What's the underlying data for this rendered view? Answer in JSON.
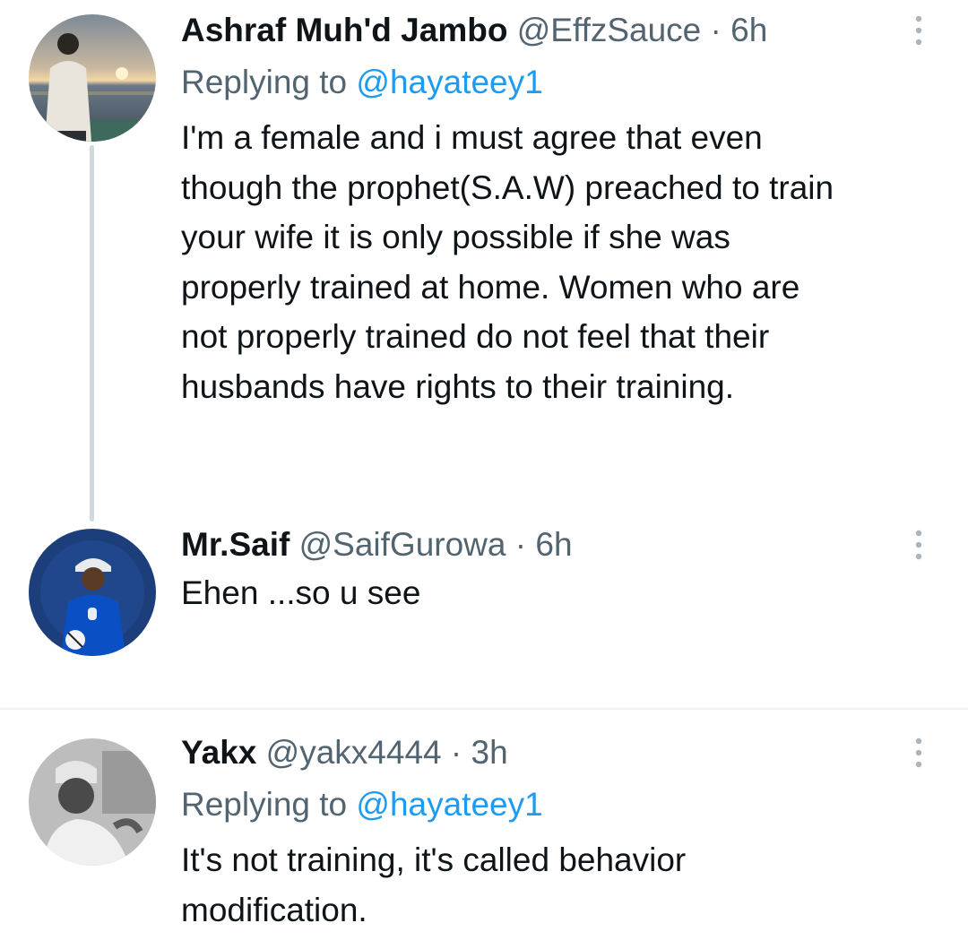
{
  "tweets": [
    {
      "name": "Ashraf Muh'd Jambo",
      "handle": "@EffzSauce",
      "separator": "·",
      "time": "6h",
      "replying_prefix": "Replying to",
      "replying_to": "@hayateey1",
      "text_lines": [
        "I'm a female and i must agree that even",
        "though the prophet(S.A.W) preached to train",
        "your wife it is only possible if she was",
        "properly trained at home. Women who are",
        "not properly trained do not feel that their",
        "husbands have rights to their training."
      ],
      "avatar_icon": "avatar-sunset-photo-icon",
      "more_icon": "more-options-icon"
    },
    {
      "name": "Mr.Saif",
      "handle": "@SaifGurowa",
      "separator": "·",
      "time": "6h",
      "text_lines": [
        "Ehen ...so u see"
      ],
      "avatar_icon": "avatar-football-player-icon",
      "more_icon": "more-options-icon"
    },
    {
      "name": "Yakx",
      "handle": "@yakx4444",
      "separator": "·",
      "time": "3h",
      "replying_prefix": "Replying to",
      "replying_to": "@hayateey1",
      "text_lines": [
        "It's not training, it's called behavior",
        "modification."
      ],
      "avatar_icon": "avatar-grayscale-person-icon",
      "more_icon": "more-options-icon"
    }
  ],
  "colors": {
    "text": "#0f1419",
    "secondary": "#536471",
    "mention": "#1d9bf0",
    "thread_line": "#cfd9de",
    "divider": "#eff3f4"
  }
}
